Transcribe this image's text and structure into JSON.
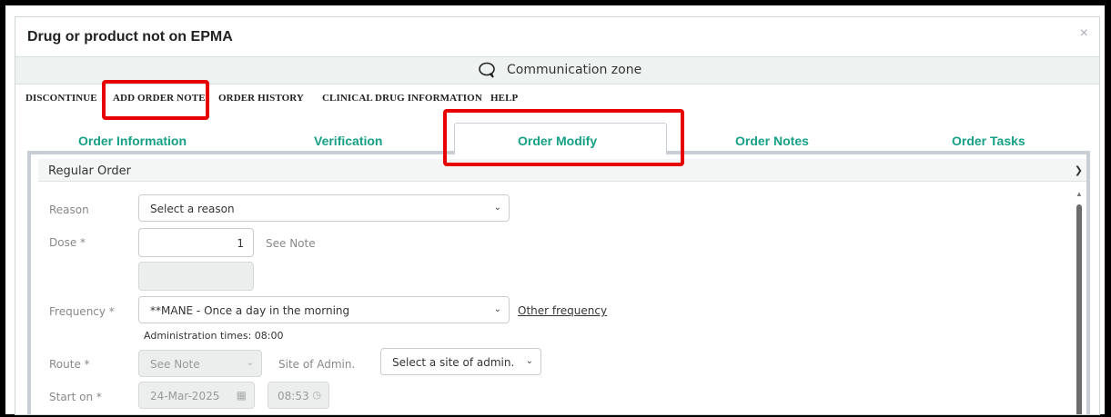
{
  "dialog": {
    "title": "Drug or product not on EPMA",
    "close_label": "×"
  },
  "communication_zone": {
    "label": "Communication zone"
  },
  "menu": [
    {
      "label": "DISCONTINUE"
    },
    {
      "label": "ADD ORDER NOTE"
    },
    {
      "label": "ORDER HISTORY"
    },
    {
      "label": "CLINICAL DRUG INFORMATION"
    },
    {
      "label": "HELP"
    }
  ],
  "tabs": [
    {
      "label": "Order Information"
    },
    {
      "label": "Verification"
    },
    {
      "label": "Order Modify",
      "active": true
    },
    {
      "label": "Order Notes"
    },
    {
      "label": "Order Tasks"
    }
  ],
  "order_type": {
    "label": "Regular Order"
  },
  "form": {
    "reason": {
      "label": "Reason",
      "value": "Select a reason"
    },
    "dose": {
      "label": "Dose *",
      "value": "1",
      "unit": "See Note"
    },
    "frequency": {
      "label": "Frequency *",
      "value": "**MANE - Once a day in the morning",
      "other_link": "Other frequency",
      "admin_times": "Administration times: 08:00"
    },
    "route": {
      "label": "Route *",
      "value": "See Note"
    },
    "site": {
      "label": "Site of Admin.",
      "value": "Select a site of admin."
    },
    "start": {
      "label": "Start on *",
      "date": "24-Mar-2025",
      "time": "08:53"
    }
  },
  "colors": {
    "tab_text": "#16a085",
    "highlight": "#e60000"
  }
}
